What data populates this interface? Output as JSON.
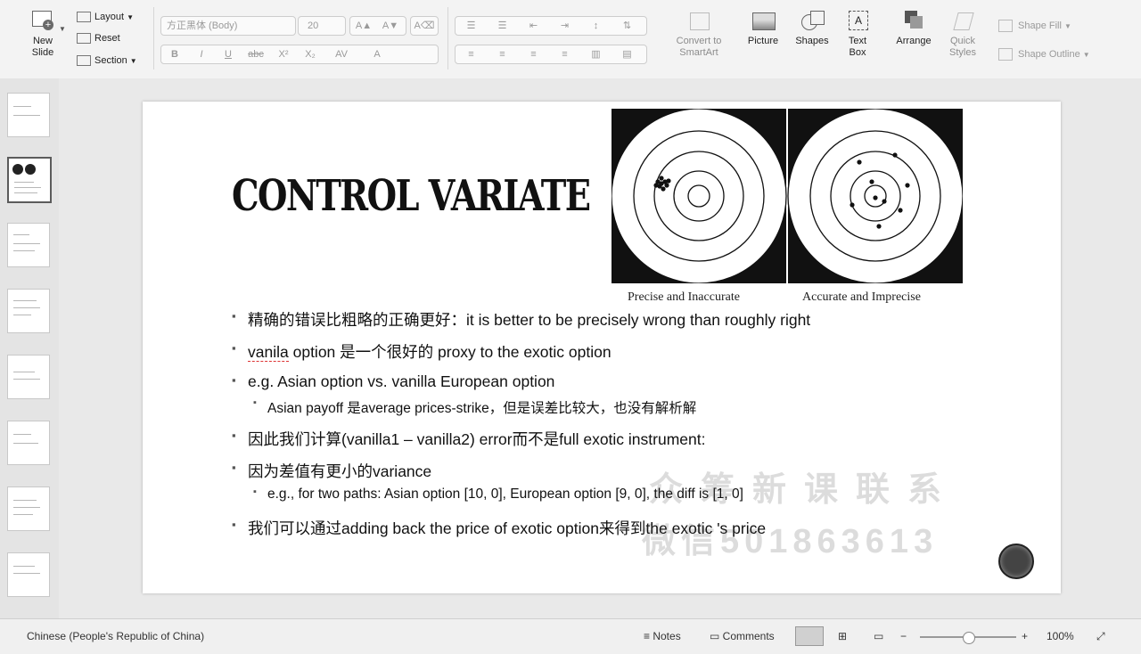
{
  "ribbon": {
    "new_slide": "New\nSlide",
    "layout": "Layout",
    "reset": "Reset",
    "section": "Section",
    "font_name": "方正黑体 (Body)",
    "font_size": "20",
    "convert_smartart": "Convert to\nSmartArt",
    "picture": "Picture",
    "shapes": "Shapes",
    "text_box": "Text\nBox",
    "arrange": "Arrange",
    "quick_styles": "Quick\nStyles",
    "shape_fill": "Shape Fill",
    "shape_outline": "Shape Outline",
    "format_buttons": [
      "B",
      "I",
      "U",
      "abc",
      "X²",
      "X₂",
      "AV",
      "A"
    ]
  },
  "slide": {
    "title": "CONTROL VARIATE",
    "caption_left": "Precise and Inaccurate",
    "caption_right": "Accurate and Imprecise",
    "bullets": [
      "精确的错误比粗略的正确更好：it is better to be precisely wrong than roughly right",
      "option 是一个很好的 proxy to the exotic option",
      "e.g. Asian option vs. vanilla European option",
      "Asian payoff 是average prices-strike，但是误差比较大，也没有解析解",
      "因此我们计算(vanilla1 – vanilla2) error而不是full exotic instrument:",
      "因为差值有更小的variance",
      "e.g., for two paths: Asian option [10, 0], European option [9, 0], the diff is [1, 0]",
      "我们可以通过adding back the price of exotic option来得到the exotic 's price"
    ],
    "bullet2_word": "vanila",
    "watermark_1": "众筹新课联系",
    "watermark_2": "微信501863613"
  },
  "status": {
    "language": "Chinese (People's Republic of China)",
    "notes": "Notes",
    "comments": "Comments",
    "zoom": "100%"
  }
}
